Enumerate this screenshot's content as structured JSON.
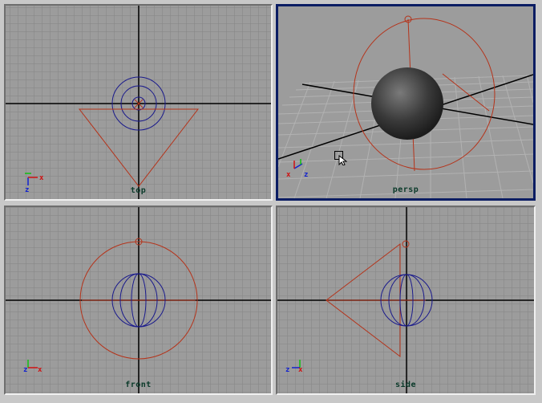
{
  "viewports": [
    {
      "id": "top",
      "label": "top",
      "axis_labels": [
        "x",
        "z"
      ],
      "active": false
    },
    {
      "id": "persp",
      "label": "persp",
      "axis_labels": [
        "x",
        "z"
      ],
      "active": true
    },
    {
      "id": "front",
      "label": "front",
      "axis_labels": [
        "z",
        "x"
      ],
      "active": false
    },
    {
      "id": "side",
      "label": "side",
      "axis_labels": [
        "z",
        "x"
      ],
      "active": false
    }
  ],
  "colors": {
    "grid_line": "#8a8a8a",
    "grid_bg": "#9a9a9a",
    "axis_line": "#000000",
    "light_wire": "#b5331a",
    "sphere_wire": "#1a1a8c",
    "active_border": "#0b1d63",
    "axis_x": "#d01010",
    "axis_y": "#10c010",
    "axis_z": "#1020d0"
  },
  "cursor_icon": "zoom-pointer-icon"
}
